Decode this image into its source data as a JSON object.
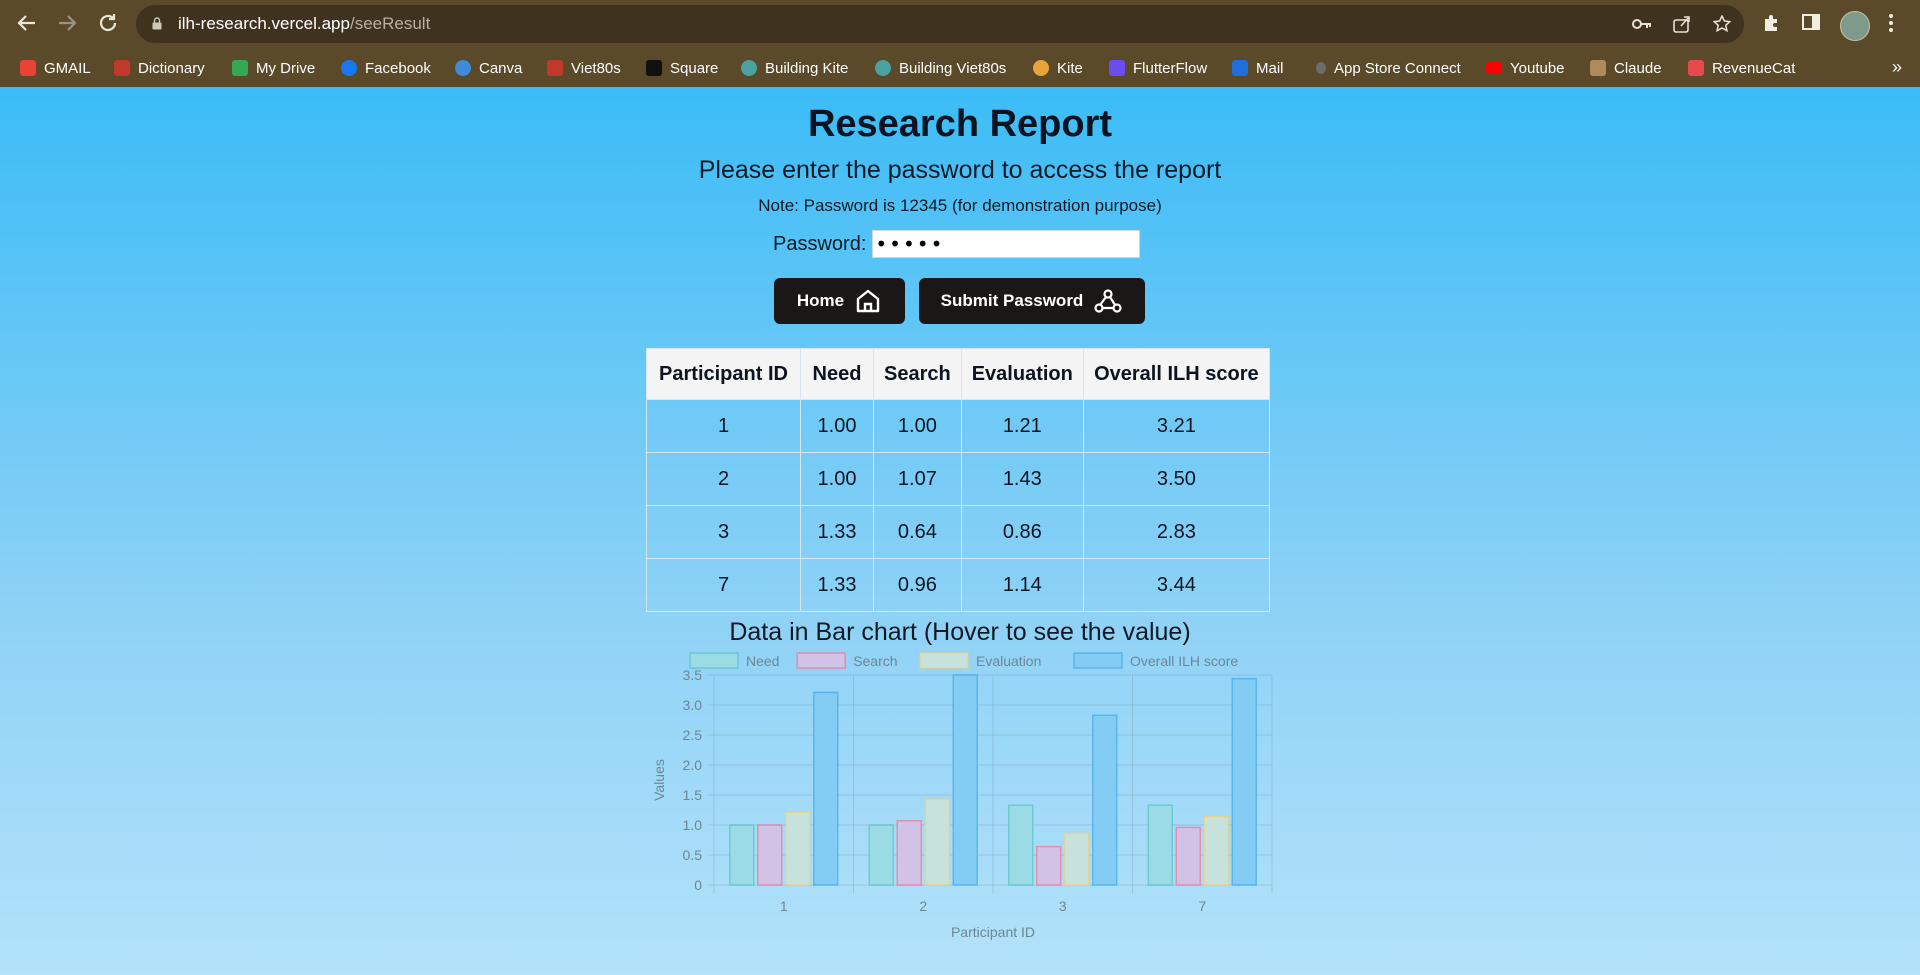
{
  "browser": {
    "url_host": "ilh-research.vercel.app",
    "url_path": "/seeResult",
    "bookmarks": [
      {
        "label": "GMAIL",
        "color": "#ea4335"
      },
      {
        "label": "Dictionary",
        "color": "#c0392b"
      },
      {
        "label": "My Drive",
        "color": "#34a853"
      },
      {
        "label": "Facebook",
        "color": "#1877f2"
      },
      {
        "label": "Canva",
        "color": "#3d8bd9"
      },
      {
        "label": "Viet80s",
        "color": "#c0392b"
      },
      {
        "label": "Square",
        "color": "#111111"
      },
      {
        "label": "Building Kite",
        "color": "#4aa3a0"
      },
      {
        "label": "Building Viet80s",
        "color": "#4aa3a0"
      },
      {
        "label": "Kite",
        "color": "#e8a33c"
      },
      {
        "label": "FlutterFlow",
        "color": "#6a4cf0"
      },
      {
        "label": "Mail",
        "color": "#1e6fd9"
      },
      {
        "label": "App Store Connect",
        "color": "#6c6c6c"
      },
      {
        "label": "Youtube",
        "color": "#ff0000"
      },
      {
        "label": "Claude",
        "color": "#b08a5a"
      },
      {
        "label": "RevenueCat",
        "color": "#e5484d"
      }
    ]
  },
  "page": {
    "title": "Research Report",
    "subtitle": "Please enter the password to access the report",
    "note": "Note: Password is 12345 (for demonstration purpose)",
    "password_label": "Password:",
    "password_value": "•••••",
    "home_button": "Home",
    "submit_button": "Submit Password"
  },
  "table": {
    "headers": [
      "Participant ID",
      "Need",
      "Search",
      "Evaluation",
      "Overall ILH score"
    ],
    "rows": [
      [
        "1",
        "1.00",
        "1.00",
        "1.21",
        "3.21"
      ],
      [
        "2",
        "1.00",
        "1.07",
        "1.43",
        "3.50"
      ],
      [
        "3",
        "1.33",
        "0.64",
        "0.86",
        "2.83"
      ],
      [
        "7",
        "1.33",
        "0.96",
        "1.14",
        "3.44"
      ]
    ]
  },
  "chart_title": "Data in Bar chart (Hover to see the value)",
  "chart_data": {
    "type": "bar",
    "categories": [
      "1",
      "2",
      "3",
      "7"
    ],
    "series": [
      {
        "name": "Need",
        "values": [
          1.0,
          1.0,
          1.33,
          1.33
        ],
        "fill": "#9adbe6",
        "stroke": "#4bc0c0"
      },
      {
        "name": "Search",
        "values": [
          1.0,
          1.07,
          0.64,
          0.96
        ],
        "fill": "#d2c3e6",
        "stroke": "#ff6384"
      },
      {
        "name": "Evaluation",
        "values": [
          1.21,
          1.43,
          0.86,
          1.14
        ],
        "fill": "#c7e2dc",
        "stroke": "#ffcd56"
      },
      {
        "name": "Overall ILH score",
        "values": [
          3.21,
          3.5,
          2.83,
          3.44
        ],
        "fill": "#83ccf4",
        "stroke": "#36a2eb"
      }
    ],
    "xlabel": "Participant ID",
    "ylabel": "Values",
    "ylim": [
      0,
      3.5
    ],
    "yticks": [
      "0",
      "0.5",
      "1.0",
      "1.5",
      "2.0",
      "2.5",
      "3.0",
      "3.5"
    ],
    "legend": "top"
  }
}
